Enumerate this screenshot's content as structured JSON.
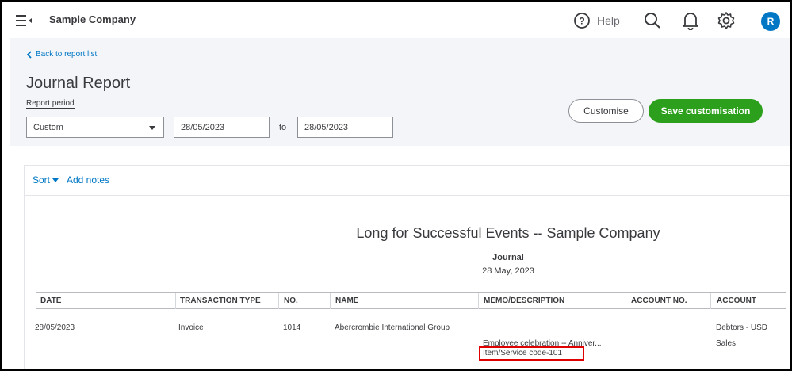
{
  "topbar": {
    "company": "Sample Company",
    "help_label": "Help",
    "avatar_initial": "R"
  },
  "header": {
    "back_link": "Back to report list",
    "title": "Journal Report",
    "period_label": "Report period",
    "period_value": "Custom",
    "from_date": "28/05/2023",
    "to_label": "to",
    "to_date": "28/05/2023",
    "customise_label": "Customise",
    "save_label": "Save customisation"
  },
  "toolbar": {
    "sort_label": "Sort",
    "add_notes_label": "Add notes"
  },
  "report": {
    "company_line": "Long for Successful Events -- Sample Company",
    "report_name": "Journal",
    "report_date": "28 May, 2023",
    "columns": [
      "DATE",
      "TRANSACTION TYPE",
      "NO.",
      "NAME",
      "MEMO/DESCRIPTION",
      "ACCOUNT NO.",
      "ACCOUNT"
    ],
    "row": {
      "date": "28/05/2023",
      "type": "Invoice",
      "no": "1014",
      "name": "Abercrombie International Group",
      "memo": "Employee celebration -- Anniver...",
      "memo_code": "Item/Service code-101",
      "account_1": "Debtors - USD",
      "account_2": "Sales"
    }
  },
  "colors": {
    "accent_blue": "#0077c5",
    "save_green": "#2ca01c",
    "highlight_red": "#e00000"
  }
}
